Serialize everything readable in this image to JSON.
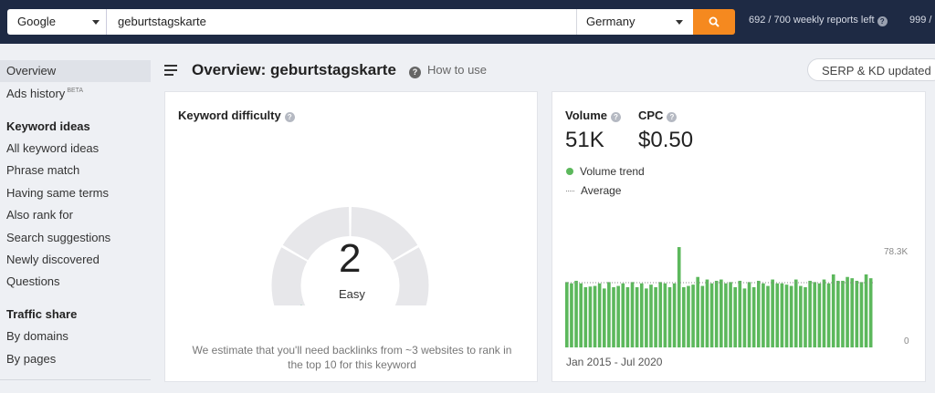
{
  "search": {
    "engine": "Google",
    "query": "geburtstagskarte",
    "country": "Germany",
    "reports": "692 / 700 weekly reports left",
    "reports2": "999 /"
  },
  "sidebar": {
    "overview": "Overview",
    "ads_history": "Ads history",
    "ads_badge": "BETA",
    "keyword_ideas_head": "Keyword ideas",
    "keyword_items": [
      "All keyword ideas",
      "Phrase match",
      "Having same terms",
      "Also rank for",
      "Search suggestions",
      "Newly discovered",
      "Questions"
    ],
    "traffic_head": "Traffic share",
    "traffic_items": [
      "By domains",
      "By pages"
    ]
  },
  "header": {
    "title": "Overview: geburtstagskarte",
    "how_to": "How to use",
    "serp_status": "SERP & KD updated"
  },
  "kd": {
    "label": "Keyword difficulty",
    "value": "2",
    "rating": "Easy",
    "note": "We estimate that you'll need backlinks from ~3 websites to rank in the top 10 for this keyword",
    "score": 2
  },
  "volume": {
    "label": "Volume",
    "value": "51K",
    "cpc_label": "CPC",
    "cpc_value": "$0.50",
    "legend_trend": "Volume trend",
    "legend_avg": "Average",
    "date_range": "Jan 2015 - Jul 2020",
    "accent": "#5cb85c"
  },
  "chart_data": {
    "type": "bar",
    "title": "",
    "xlabel": "",
    "ylabel": "",
    "ylim": [
      0,
      78300
    ],
    "y_tick_labels": [
      "78.3K",
      "0"
    ],
    "x_range": "Jan 2015 - Jul 2020",
    "series": [
      {
        "values": [
          51000,
          50000,
          52000,
          50000,
          47000,
          47500,
          48000,
          50000,
          46000,
          51000,
          47000,
          48000,
          50000,
          47000,
          51000,
          47000,
          50000,
          46000,
          49000,
          47000,
          51000,
          50000,
          47000,
          50000,
          78300,
          47000,
          48000,
          49000,
          55000,
          48000,
          53000,
          50000,
          52000,
          53000,
          50000,
          51000,
          47000,
          52000,
          46000,
          51000,
          47000,
          52000,
          50000,
          48000,
          53000,
          50000,
          50000,
          49000,
          48000,
          53000,
          48000,
          47000,
          52000,
          51000,
          50000,
          53000,
          50000,
          57000,
          52000,
          52000,
          55000,
          54000,
          52000,
          51000,
          57000,
          54000
        ]
      }
    ]
  }
}
